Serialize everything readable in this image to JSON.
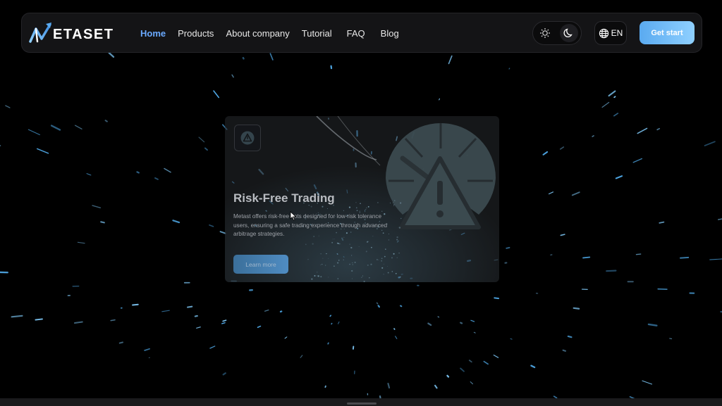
{
  "brand": {
    "logo_text": "ETASET",
    "accent": "#5aaaf0"
  },
  "nav": {
    "links": [
      {
        "label": "Home",
        "active": true
      },
      {
        "label": "Products",
        "active": false
      },
      {
        "label": "About company",
        "active": false
      },
      {
        "label": "Tutorial",
        "active": false
      },
      {
        "label": "FAQ",
        "active": false
      },
      {
        "label": "Blog",
        "active": false
      }
    ]
  },
  "header": {
    "theme_icons": [
      "sun-icon",
      "moon-icon"
    ],
    "language": "EN",
    "cta_label": "Get start"
  },
  "card": {
    "title": "Risk-Free Trading",
    "description": "Metast offers risk-free bots designed for low-risk tolerance users, ensuring a safe trading experience through advanced arbitrage strategies.",
    "button_label": "Learn more",
    "icon": "warning-triangle-icon"
  }
}
